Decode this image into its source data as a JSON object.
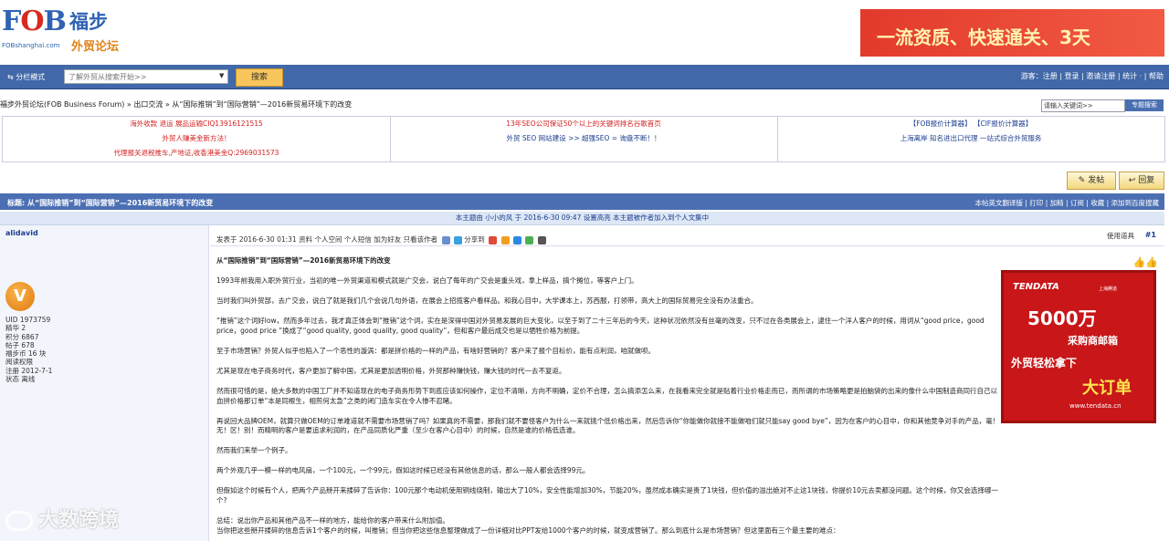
{
  "header": {
    "logo_text": "FOB",
    "logo_sub": "FOBshanghai.com",
    "logo_cn": "福步",
    "logo_cn_sub": "外贸论坛",
    "banner_text": "一流资质、快速通关、3天"
  },
  "nav": {
    "mode_label": "分栏模式",
    "search_placeholder": "了解外贸从搜索开始>>",
    "search_button": "搜索",
    "right_links": "游客：注册 | 登录 | 邀请注册 | 统计 · | 帮助"
  },
  "breadcrumb": "福步外贸论坛(FOB Business Forum) » 出口交流 » 从“国际推销”到“国际营销”—2016新贸易环境下的改变",
  "goto": {
    "placeholder": "请输入关键词>>",
    "button": "专题搜索"
  },
  "ads": {
    "r1c1": "海外收款 退运 展品运输CIQ13916121515",
    "r1c2": "13年SEO公司保证50个以上的关键词排名谷歌首页",
    "r1c3": "【FOB报价计算器】 【CIF报价计算器】",
    "r2c1": "外贸人赚美金新方法！",
    "r2c2": "外贸 SEO 网站建设 >> 超强SEO = 询盘不断！！",
    "r2c3": "上海离岸 知名进出口代理 一站式综合外贸服务",
    "r3c1": "代理报关退税推车,产地证,收香港美金Q:2969031573"
  },
  "buttons": {
    "post": "发帖",
    "reply": "回复"
  },
  "thread": {
    "title": "标题: 从“国际推销”到“国际营销”—2016新贸易环境下的改变",
    "title_links": "本帖英文翻译版 | 打印 | 加精 | 订阅 | 收藏 | 添加到百度搜藏",
    "notice": "本主题由 小小的风 于 2016-6-30 09:47 设置高亮    本主题被作者加入到个人文集中"
  },
  "user": {
    "name": "alidavid",
    "avatar_letter": "V",
    "stats": [
      "UID 1973759",
      "精华 2",
      "积分 6867",
      "帖子 678",
      "福步币 16 块",
      "阅读权限",
      "注册 2012-7-1",
      "状态 离线"
    ]
  },
  "post": {
    "meta": "发表于 2016-6-30 01:31  资料  个人空间  个人短信  加为好友  只看该作者",
    "share": "分享到",
    "tools": "使用道具",
    "floor": "#1",
    "heading": "从“国际推销”到“国际营销”—2016新贸易环境下的改变",
    "p1": "1993年前我用入职外贸行业，当初的唯一外贸渠道和模式就是广交会，说白了每年的广交会是重头戏，拿上样品，搞个摊位，等客户上门。",
    "p2": "当时我们叫外贸部，去广交会，说白了就是我们几个会说几句外语，在展会上招揽客户看样品。和我心目中，大学课本上，苏西服，打领带，高大上的国际贸易完全没有办法重合。",
    "p3": "“推销”这个词好low，然而多年过去，我才真正体会到“推销”这个词，实在是深得中国对外贸易发展的巨大变化，以至于到了二十三年后的今天，这种状况依然没有丝毫的改变，只不过在各类展会上，逮住一个洋人客户的时候，用词从“good price，good price，good price ”换成了“good quality, good quality, good quality”，但和客户最后成交也是以牺牲价格为前提。",
    "p4": "至于市场营销？外贸人似乎也陷入了一个恶性的漩涡：都是拼价格的一样的产品，有啥好营销的？客户来了报个目标价，能有点利润，咱就做呗。",
    "p5": "尤其是现在电子商务时代，客户更加了解中国，尤其是更加透明价格，外贸那种赚快钱，赚大钱的时代一去不复返。",
    "p6": "然而很可惜的是，绝大多数的中国工厂并不知道现在的电子商务形势下到底应该如何操作，定位不清晰，方向不明确，定价不合理，怎么搞添怎么来，在我看来完全就是贴着行业价格走而已，而所谓的市场策略更是拍脑袋的出来的像什么中国制造商同行自己以血拼价格那订单“本是同根生，相煎何太急”之类的闭门造车实在令人惨不忍睹。",
    "p7": "再说回大品牌OEM，就算只做OEM的订单难道就不需要市场营销了吗？如果真的不需要，那我们就不要怪客户为什么一来就挑个低价格出来，然后告诉你“你能做你就接不能做咱们就只能say good bye”，因为在客户的心目中，你和其他竞争对手的产品，毫！无！区！别！而精明的客户是要追求利润的，在产品同质化严重（至少在客户心目中）的时候，自然是谁的价格低选谁。",
    "p8": "然而我们来举一个例子。",
    "p9": "两个外观几乎一模一样的电风扇，一个100元，一个99元，假如这时候已经没有其他信息的话，那么一般人都会选择99元。",
    "p10": "但假如这个时候有个人，把两个产品掰开来揉碎了告诉你：100元那个电动机使用铜线绕制，输出大了10%，安全性能增加30%，节能20%，虽然成本确实是贵了1块钱，但价值的溢出绝对不止这1块钱，你提价10元去卖都没问题。这个时候，你又会选择哪一个?",
    "p11a": "总结：说出你产品和其他产品不一样的地方，能给你的客户带来什么附加值。",
    "p11b": "当你把这些掰开揉碎的信息告诉1个客户的时候，叫推销；但当你把这些信息整理做成了一份详细对比PPT发给1000个客户的时候，就变成营销了。那么到底什么是市场营销？但这里面有三个最主要的难点："
  },
  "right_ad": {
    "brand": "TENDATA",
    "brand_sub": "上海腾道",
    "big": "5000万",
    "line2": "采购商邮箱",
    "line3": "外贸轻松拿下",
    "line4": "大订单",
    "url": "www.tendata.cn"
  },
  "watermark": "大数跨境"
}
